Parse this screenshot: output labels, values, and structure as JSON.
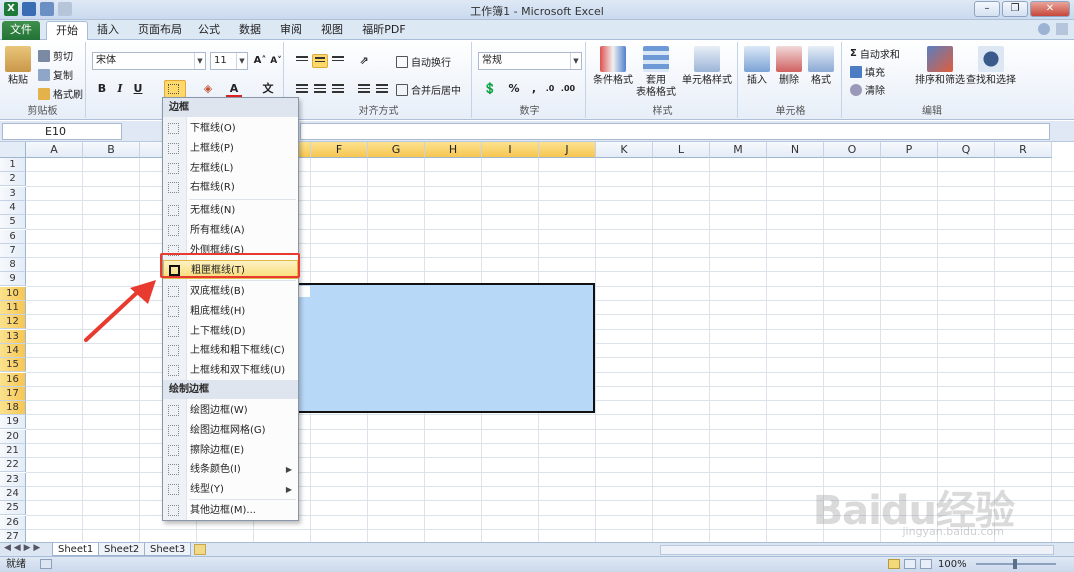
{
  "window": {
    "title": "工作簿1 - Microsoft Excel"
  },
  "tabs": [
    "文件",
    "开始",
    "插入",
    "页面布局",
    "公式",
    "数据",
    "审阅",
    "视图",
    "福昕PDF"
  ],
  "ribbon": {
    "clipboard": {
      "paste": "粘贴",
      "cut": "剪切",
      "copy": "复制",
      "painter": "格式刷",
      "label": "剪贴板"
    },
    "font": {
      "name": "宋体",
      "size": "11",
      "bold": "B",
      "italic": "I",
      "underline": "U"
    },
    "alignment": {
      "wrap": "自动换行",
      "merge": "合并后居中",
      "label": "对齐方式"
    },
    "number": {
      "format": "常规",
      "label": "数字"
    },
    "styles": {
      "conditional": "条件格式",
      "table_l1": "套用",
      "table_l2": "表格格式",
      "cell_styles": "单元格样式",
      "label": "样式"
    },
    "cells": {
      "insert": "插入",
      "delete": "删除",
      "format": "格式",
      "label": "单元格"
    },
    "editing": {
      "autosum": "自动求和",
      "fill": "填充",
      "clear": "清除",
      "sort": "排序和筛选",
      "find": "查找和选择",
      "label": "编辑"
    }
  },
  "formula_bar": {
    "namebox": "E10"
  },
  "columns": [
    "A",
    "B",
    "C",
    "D",
    "E",
    "F",
    "G",
    "H",
    "I",
    "J",
    "K",
    "L",
    "M",
    "N",
    "O",
    "P",
    "Q",
    "R"
  ],
  "rows": [
    "1",
    "2",
    "3",
    "4",
    "5",
    "6",
    "7",
    "8",
    "9",
    "10",
    "11",
    "12",
    "13",
    "14",
    "15",
    "16",
    "17",
    "18",
    "19",
    "20",
    "21",
    "22",
    "23",
    "24",
    "25",
    "26",
    "27"
  ],
  "sheets": [
    "Sheet1",
    "Sheet2",
    "Sheet3"
  ],
  "status": {
    "ready": "就绪",
    "zoom": "100%"
  },
  "menu": {
    "header1": "边框",
    "items1": [
      "下框线(O)",
      "上框线(P)",
      "左框线(L)",
      "右框线(R)"
    ],
    "items2": [
      "无框线(N)",
      "所有框线(A)",
      "外侧框线(S)",
      "粗匣框线(T)"
    ],
    "items3": [
      "双底框线(B)",
      "粗底框线(H)",
      "上下框线(D)",
      "上框线和粗下框线(C)",
      "上框线和双下框线(U)"
    ],
    "header2": "绘制边框",
    "items4": [
      "绘图边框(W)",
      "绘图边框网格(G)",
      "擦除边框(E)",
      "线条颜色(I)",
      "线型(Y)"
    ],
    "items5": [
      "其他边框(M)..."
    ]
  },
  "watermark": {
    "text": "Baidu经验",
    "sub": "jingyan.baidu.com"
  }
}
